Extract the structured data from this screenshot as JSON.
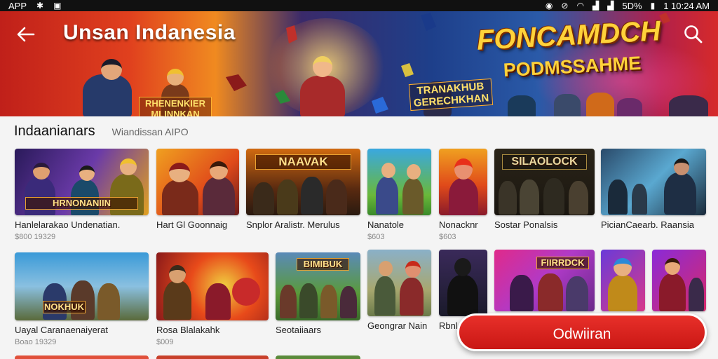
{
  "status_bar": {
    "left_label": "APP",
    "battery": "5D%",
    "time": "1 10:24 AM"
  },
  "header": {
    "title": "Unsan Indanesia",
    "back_icon": "arrow-left-icon",
    "search_icon": "search-icon"
  },
  "hero": {
    "logo_main": "FONCAMDCH",
    "logo_sub": "PODMSSAHME",
    "logo_left": "RHENENKIER MLINNKAN",
    "logo_mid": "TRANAKHUB GERECHKHAN"
  },
  "section": {
    "title": "Indaanianars",
    "subtitle": "Wiandissan AIPO"
  },
  "row1": [
    {
      "title": "Hanlelarakao Undenatian.",
      "price": "$800 19329",
      "banner": "HRNONANIIN"
    },
    {
      "title": "Hart Gl Goonnaig",
      "price": "",
      "banner": ""
    },
    {
      "title": "Snplor Aralistr. Merulus",
      "price": "",
      "banner": "NAAVAK"
    },
    {
      "title": "Nanatole",
      "price": "$603",
      "banner": ""
    },
    {
      "title": "Nonacknr",
      "price": "$603",
      "banner": ""
    },
    {
      "title": "Sostar Ponalsis",
      "price": "",
      "banner": "SILAOLOCK"
    },
    {
      "title": "PicianCaearb. Raansia",
      "price": "",
      "banner": ""
    }
  ],
  "row2": [
    {
      "title": "Uayal Caranaenaiyerat",
      "price": "Boao 19329",
      "banner": "NOKHUK"
    },
    {
      "title": "Rosa Blalakahk",
      "price": "$009",
      "banner": ""
    },
    {
      "title": "Seotaiiaars",
      "price": "",
      "banner": "BIMIBUK"
    },
    {
      "title": "Geongrar Nain",
      "price": "",
      "banner": ""
    },
    {
      "title": "Rbnl",
      "price": "",
      "banner": ""
    },
    {
      "title": "",
      "price": "",
      "banner": "FIIRRDCK"
    },
    {
      "title": "",
      "price": "",
      "banner": ""
    },
    {
      "title": "",
      "price": "",
      "banner": ""
    }
  ],
  "download": {
    "label": "Odwiiran"
  },
  "colors": {
    "accent": "#d8201c",
    "background": "#f4f4f4"
  }
}
